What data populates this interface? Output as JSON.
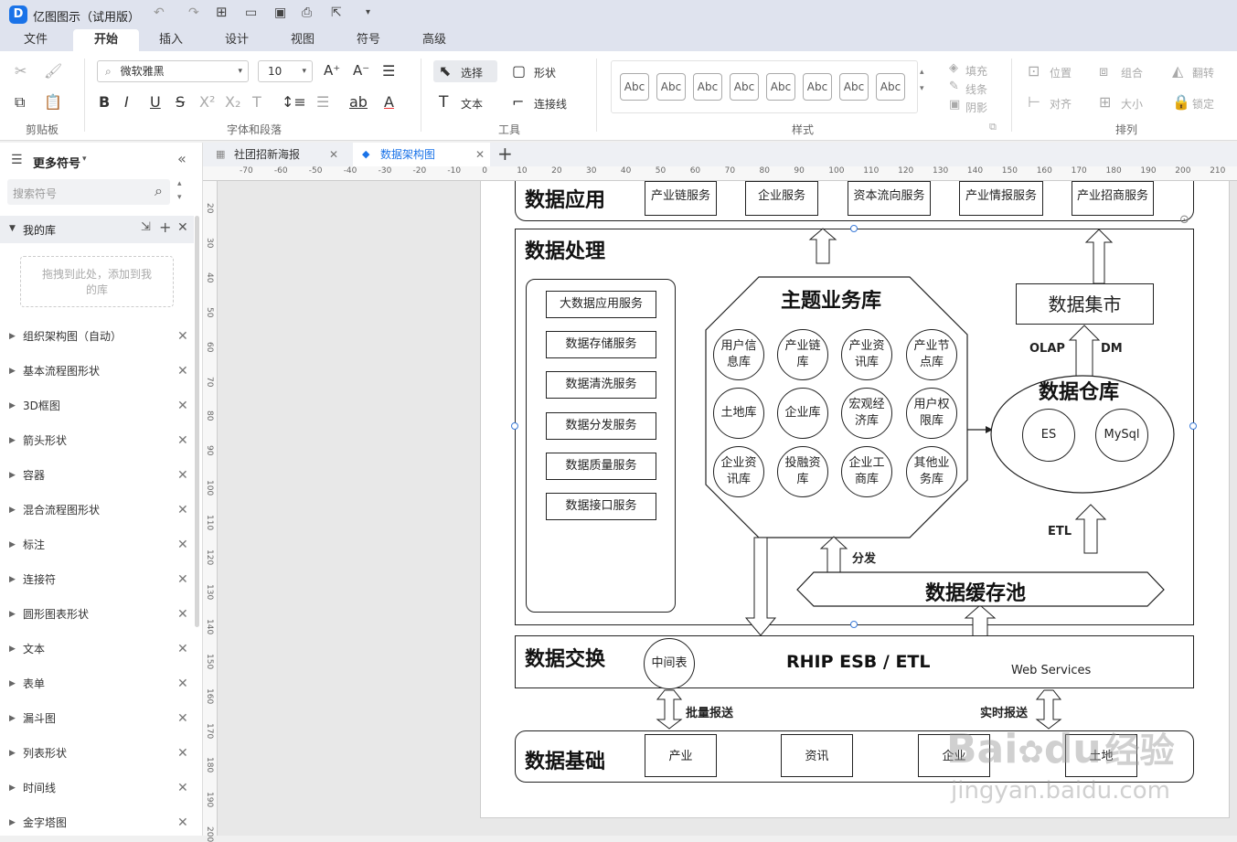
{
  "app": {
    "title": "亿图图示（试用版）"
  },
  "menu": {
    "tabs": [
      "文件",
      "开始",
      "插入",
      "设计",
      "视图",
      "符号",
      "高级"
    ]
  },
  "ribbon": {
    "font_name": "微软雅黑",
    "font_size": "10",
    "select_label": "选择",
    "shape_label": "形状",
    "text_label": "文本",
    "connector_label": "连接线",
    "style_samples": [
      "Abc",
      "Abc",
      "Abc",
      "Abc",
      "Abc",
      "Abc",
      "Abc",
      "Abc"
    ],
    "fill_label": "填充",
    "line_label": "线条",
    "shadow_label": "阴影",
    "position_label": "位置",
    "group_label": "组合",
    "flip_label": "翻转",
    "align_label": "对齐",
    "size_label": "大小",
    "lock_label": "锁定",
    "group_labels": {
      "clipboard": "剪贴板",
      "font_paragraph": "字体和段落",
      "tools": "工具",
      "styles": "样式",
      "arrange": "排列"
    }
  },
  "sidebar": {
    "title": "更多符号",
    "search_placeholder": "搜索符号",
    "my_library": "我的库",
    "drop_hint": "拖拽到此处，添加到我的库",
    "libraries": [
      "组织架构图（自动）",
      "基本流程图形状",
      "3D框图",
      "箭头形状",
      "容器",
      "混合流程图形状",
      "标注",
      "连接符",
      "圆形图表形状",
      "文本",
      "表单",
      "漏斗图",
      "列表形状",
      "时间线",
      "金字塔图"
    ]
  },
  "doc_tabs": [
    {
      "label": "社团招新海报",
      "active": false
    },
    {
      "label": "数据架构图",
      "active": true
    }
  ],
  "ruler": {
    "top": [
      "-70",
      "-60",
      "-50",
      "-40",
      "-30",
      "-20",
      "-10",
      "0",
      "10",
      "20",
      "30",
      "40",
      "50",
      "60",
      "70",
      "80",
      "90",
      "100",
      "110",
      "120",
      "130",
      "140",
      "150",
      "160",
      "170",
      "180",
      "190",
      "200",
      "210"
    ],
    "left": [
      "20",
      "30",
      "40",
      "50",
      "60",
      "70",
      "80",
      "90",
      "100",
      "110",
      "120",
      "130",
      "140",
      "150",
      "160",
      "170",
      "180",
      "190",
      "200"
    ]
  },
  "diagram": {
    "app_layer": {
      "title": "数据应用",
      "services": [
        "产业链服务",
        "企业服务",
        "资本流向服务",
        "产业情报服务",
        "产业招商服务"
      ]
    },
    "processing": {
      "title": "数据处理",
      "services": [
        "大数据应用服务",
        "数据存储服务",
        "数据清洗服务",
        "数据分发服务",
        "数据质量服务",
        "数据接口服务"
      ],
      "theme_db": {
        "title": "主题业务库",
        "items": [
          "用户信息库",
          "产业链库",
          "产业资讯库",
          "产业节点库",
          "土地库",
          "企业库",
          "宏观经济库",
          "用户权限库",
          "企业资讯库",
          "投融资库",
          "企业工商库",
          "其他业务库"
        ]
      },
      "mart": "数据集市",
      "olap": "OLAP",
      "dm": "DM",
      "warehouse": {
        "title": "数据仓库",
        "es": "ES",
        "mysql": "MySql"
      },
      "etl": "ETL",
      "distribute": "分发",
      "cache_pool": "数据缓存池"
    },
    "exchange": {
      "title": "数据交换",
      "middle_table": "中间表",
      "bus": "RHIP ESB / ETL",
      "web_services": "Web Services"
    },
    "batch_report": "批量报送",
    "realtime_report": "实时报送",
    "foundation": {
      "title": "数据基础",
      "items": [
        "产业",
        "资讯",
        "企业",
        "土地"
      ]
    }
  },
  "watermark": {
    "text1": "Bai",
    "text2": "du",
    "text3": "经验",
    "url": "jingyan.baidu.com"
  },
  "colors": {
    "accent": "#1a73e8",
    "chrome": "#dfe3ee"
  }
}
